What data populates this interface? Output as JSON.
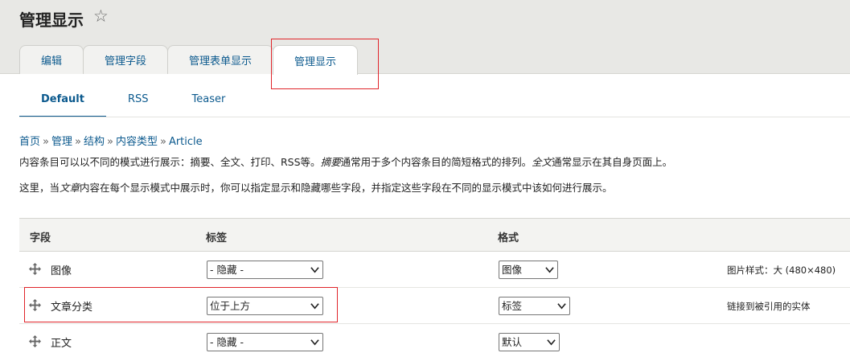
{
  "page": {
    "title": "管理显示"
  },
  "primary_tabs": [
    {
      "label": "编辑"
    },
    {
      "label": "管理字段"
    },
    {
      "label": "管理表单显示"
    },
    {
      "label": "管理显示",
      "active": true
    }
  ],
  "secondary_tabs": [
    {
      "label": "Default",
      "active": true
    },
    {
      "label": "RSS"
    },
    {
      "label": "Teaser"
    }
  ],
  "breadcrumb": [
    {
      "label": "首页"
    },
    {
      "label": "管理"
    },
    {
      "label": "结构"
    },
    {
      "label": "内容类型"
    },
    {
      "label": "Article"
    }
  ],
  "breadcrumb_separator": "»",
  "description": {
    "line1_a": "内容条目可以以不同的模式进行展示：摘要、全文、打印、RSS等。",
    "line1_em": "摘要",
    "line1_b": "通常用于多个内容条目的简短格式的排列。",
    "line1_em2": "全文",
    "line1_c": "通常显示在其自身页面上。",
    "line2_a": "这里，当",
    "line2_em": "文章",
    "line2_b": "内容在每个显示模式中展示时，你可以指定显示和隐藏哪些字段，并指定这些字段在不同的显示模式中该如何进行展示。"
  },
  "table": {
    "headers": {
      "field": "字段",
      "label": "标签",
      "format": "格式"
    },
    "rows": [
      {
        "field": "图像",
        "label_select": "- 隐藏 -",
        "format_select": "图像",
        "summary": "图片样式：大 (480×480)"
      },
      {
        "field": "文章分类",
        "label_select": "位于上方",
        "format_select": "标签",
        "summary": "链接到被引用的实体"
      },
      {
        "field": "正文",
        "label_select": "- 隐藏 -",
        "format_select": "默认",
        "summary": ""
      }
    ]
  },
  "colors": {
    "link": "#0c5a8e",
    "highlight_box": "#e0242a",
    "header_band": "#e8e8e5"
  },
  "icons": {
    "star": "star-outline-icon",
    "drag": "move-handle-icon",
    "select_arrow": "chevron-down-icon"
  }
}
